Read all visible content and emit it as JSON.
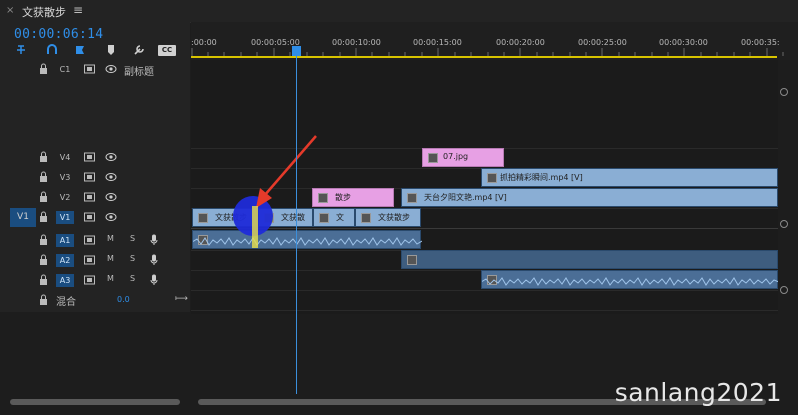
{
  "tab": {
    "close": "×",
    "title": "文获散步",
    "menu": "≡"
  },
  "timecode": "00:00:06:14",
  "tools": [
    "snap-icon",
    "linked-selection-icon",
    "add-marker-icon",
    "marker-icon",
    "wrench-icon",
    "captions-icon"
  ],
  "tool_cc": "CC",
  "ruler": {
    "labels": [
      ":00:00",
      "00:00:05:00",
      "00:00:10:00",
      "00:00:15:00",
      "00:00:20:00",
      "00:00:25:00",
      "00:00:30:00",
      "00:00:35:"
    ]
  },
  "tracks": {
    "c1": {
      "name": "C1",
      "label": "副标题"
    },
    "v4": {
      "name": "V4"
    },
    "v3": {
      "name": "V3"
    },
    "v2": {
      "name": "V2"
    },
    "v1": {
      "name": "V1",
      "source": "V1"
    },
    "a1": {
      "name": "A1",
      "m": "M",
      "s": "S"
    },
    "a2": {
      "name": "A2",
      "m": "M",
      "s": "S"
    },
    "a3": {
      "name": "A3",
      "m": "M",
      "s": "S"
    },
    "mix": {
      "label": "混合",
      "value": "0.0"
    }
  },
  "clips": {
    "v4_1": "07.jpg",
    "v3_1": "抓拍精彩瞬间.mp4 [V]",
    "v2_1": "散步",
    "v2_2": "天台夕阳文艳.mp4 [V]",
    "v1_1": "文获散步",
    "v1_2": "文获散",
    "v1_3": "文",
    "v1_4": "文获散步"
  },
  "watermark": "sanlang2021",
  "colors": {
    "accent": "#2f8ee8",
    "clip_video": "#8aaed4",
    "clip_graphic": "#e7a0e4",
    "work_area": "#d8c400"
  }
}
